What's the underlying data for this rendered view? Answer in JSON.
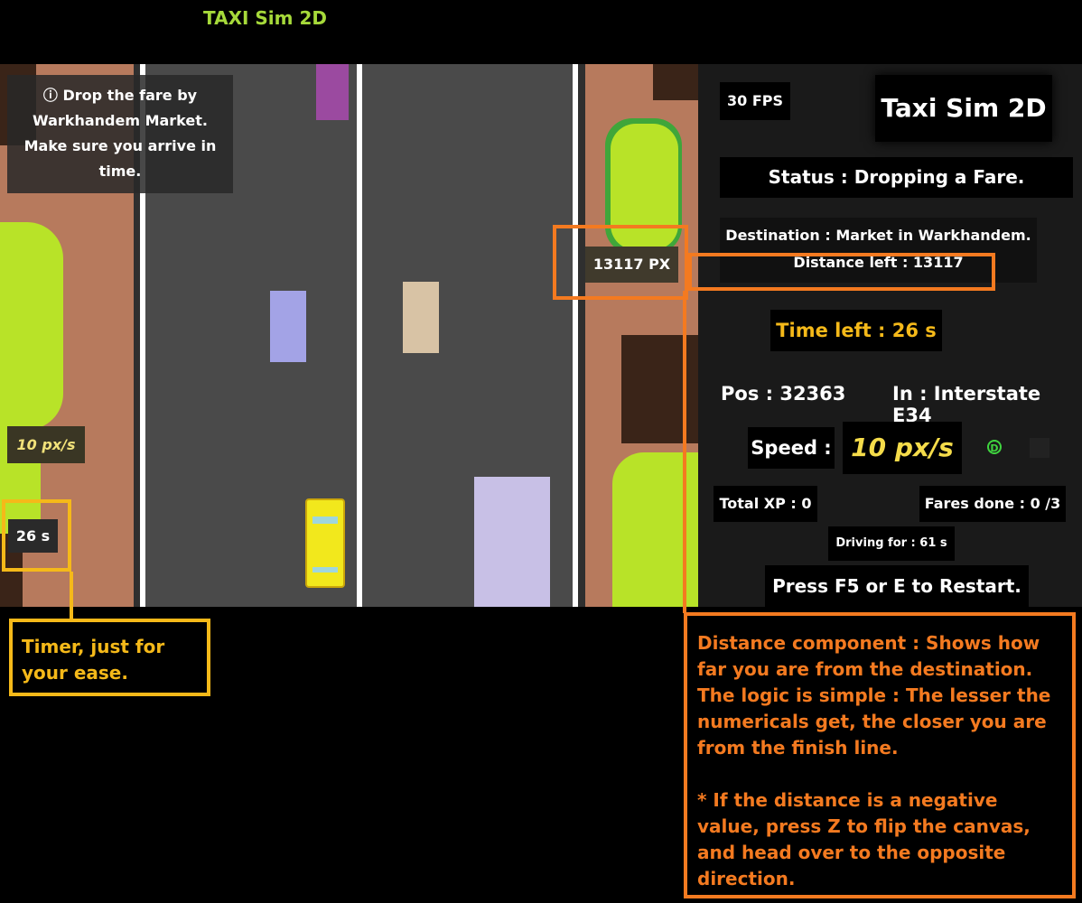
{
  "app_title": "TAXI Sim 2D",
  "game": {
    "hint": "ⓘ Drop the fare by Warkhandem Market. Make sure you arrive in time.",
    "distance_badge": "13117 PX",
    "speed_badge": "10 px/s",
    "timer_badge": "26 s"
  },
  "panel": {
    "fps": "30 FPS",
    "title": "Taxi Sim 2D",
    "status": "Status : Dropping a Fare.",
    "destination": "Destination : Market in Warkhandem.",
    "distance_left": "Distance left : 13117",
    "time_left": "Time left : 26 s",
    "pos": "Pos : 32363",
    "in_road": "In : Interstate E34",
    "speed_label": "Speed :",
    "speed_value": "10 px/s",
    "gear_icon_text": "D",
    "total_xp": "Total XP : 0",
    "fares_done": "Fares done : 0 /3",
    "driving_for": "Driving for : 61 s",
    "restart": "Press F5 or E to Restart."
  },
  "annotations": {
    "timer_note": "Timer, just for your ease.",
    "distance_note_1": "Distance component : Shows how far you are from the destination. The logic is simple : The lesser the numericals get, the closer you are from the finish line.",
    "distance_note_2": "* If the distance is a negative value, press Z to flip the canvas, and head over to the opposite direction."
  },
  "colors": {
    "title_green": "#a6d93a",
    "annotation_orange": "#f47a20",
    "annotation_yellow": "#f5b919",
    "speed_yellow": "#f5dc4a",
    "gear_green": "#3fd43f",
    "road": "#4a4a4a",
    "dirt": "#b77a5d",
    "grass": "#b8e328"
  }
}
